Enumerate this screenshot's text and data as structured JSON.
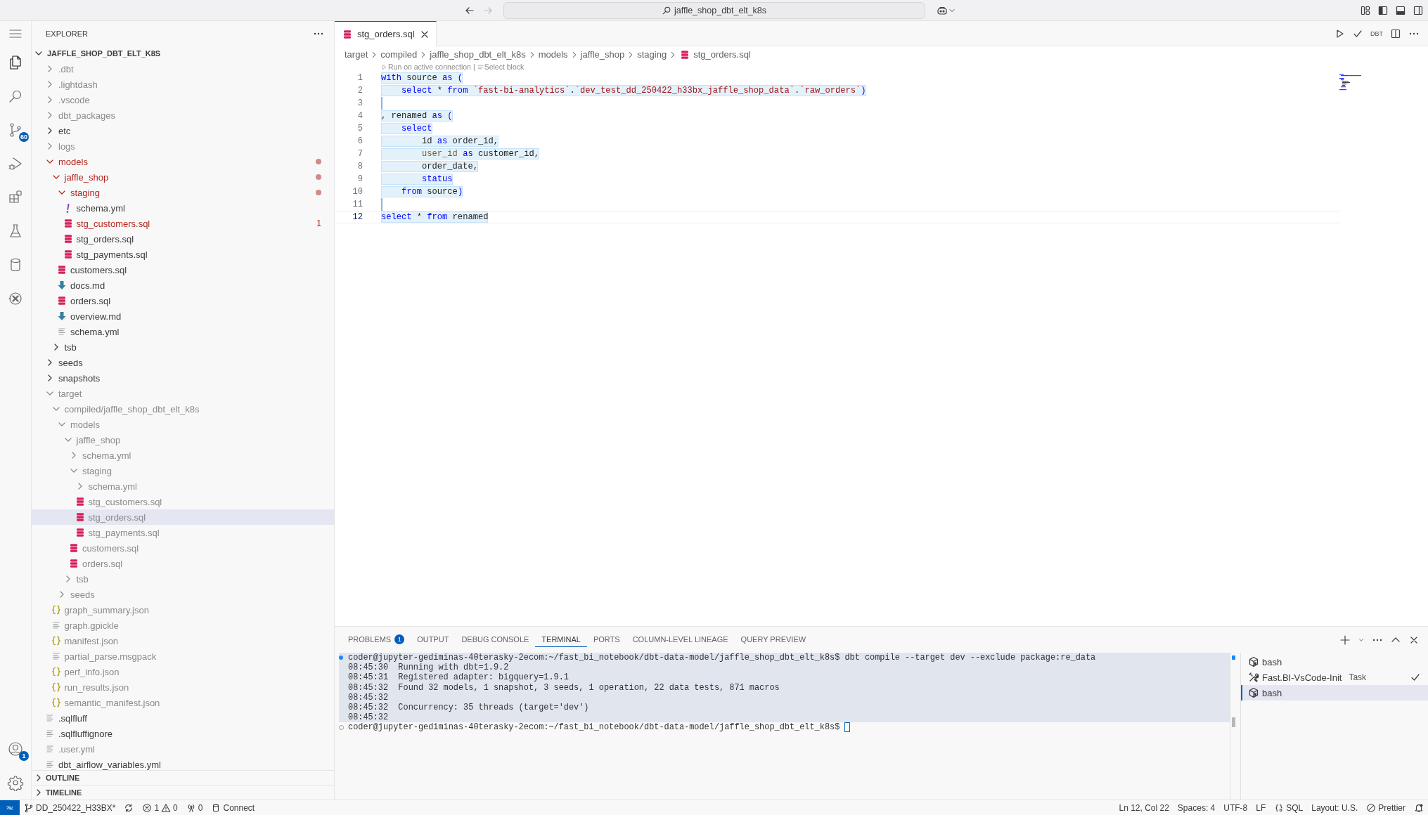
{
  "title_bar": {
    "navigation": [
      {
        "kind": "back",
        "disabled": false
      },
      {
        "kind": "forward",
        "disabled": true
      }
    ],
    "search": {
      "value": "jaffle_shop_dbt_elt_k8s"
    }
  },
  "activity_bar": {
    "items": [
      {
        "kind": "menu",
        "selected": false
      },
      {
        "kind": "explorer",
        "selected": true
      },
      {
        "kind": "search",
        "selected": false
      },
      {
        "kind": "source-control",
        "badge": "60",
        "selected": false
      },
      {
        "kind": "run-debug",
        "selected": false
      },
      {
        "kind": "extensions",
        "selected": false
      },
      {
        "kind": "testing",
        "selected": false
      },
      {
        "kind": "database",
        "selected": false
      },
      {
        "kind": "dbt",
        "selected": false
      }
    ],
    "bottom": [
      {
        "kind": "account",
        "badge": "1"
      },
      {
        "kind": "settings"
      }
    ]
  },
  "explorer": {
    "title": "EXPLORER",
    "root": {
      "name": "JAFFLE_SHOP_DBT_ELT_K8S",
      "expanded": true,
      "children": [
        {
          "name": ".dbt",
          "kind": "folder",
          "expanded": false,
          "ignored": true,
          "modified": false,
          "selected": false
        },
        {
          "name": ".lightdash",
          "kind": "folder",
          "expanded": false,
          "ignored": true,
          "modified": false,
          "selected": false
        },
        {
          "name": ".vscode",
          "kind": "folder",
          "expanded": false,
          "ignored": true,
          "modified": false,
          "selected": false
        },
        {
          "name": "dbt_packages",
          "kind": "folder",
          "expanded": false,
          "ignored": true,
          "modified": false,
          "selected": false
        },
        {
          "name": "etc",
          "kind": "folder",
          "expanded": false,
          "ignored": false,
          "modified": false,
          "selected": false
        },
        {
          "name": "logs",
          "kind": "folder",
          "expanded": false,
          "ignored": true,
          "modified": false,
          "selected": false
        },
        {
          "name": "models",
          "kind": "folder",
          "expanded": true,
          "ignored": false,
          "modified": true,
          "selected": false,
          "children": [
            {
              "name": "jaffle_shop",
              "kind": "folder",
              "expanded": true,
              "ignored": false,
              "modified": true,
              "selected": false,
              "children": [
                {
                  "name": "staging",
                  "kind": "folder",
                  "expanded": true,
                  "ignored": false,
                  "modified": true,
                  "selected": false,
                  "children": [
                    {
                      "name": "schema.yml",
                      "kind": "yml-warn",
                      "ignored": false,
                      "modified": false,
                      "selected": false
                    },
                    {
                      "name": "stg_customers.sql",
                      "kind": "sql",
                      "ignored": false,
                      "modified": false,
                      "problems": "1",
                      "selected": false
                    },
                    {
                      "name": "stg_orders.sql",
                      "kind": "sql",
                      "ignored": false,
                      "modified": false,
                      "selected": false
                    },
                    {
                      "name": "stg_payments.sql",
                      "kind": "sql",
                      "ignored": false,
                      "modified": false,
                      "selected": false
                    }
                  ]
                },
                {
                  "name": "customers.sql",
                  "kind": "sql",
                  "ignored": false,
                  "modified": false,
                  "selected": false
                },
                {
                  "name": "docs.md",
                  "kind": "markdown",
                  "ignored": false,
                  "modified": false,
                  "selected": false
                },
                {
                  "name": "orders.sql",
                  "kind": "sql",
                  "ignored": false,
                  "modified": false,
                  "selected": false
                },
                {
                  "name": "overview.md",
                  "kind": "markdown",
                  "ignored": false,
                  "modified": false,
                  "selected": false
                },
                {
                  "name": "schema.yml",
                  "kind": "text",
                  "ignored": false,
                  "modified": false,
                  "selected": false
                }
              ]
            },
            {
              "name": "tsb",
              "kind": "folder",
              "expanded": false,
              "ignored": false,
              "modified": false,
              "selected": false
            }
          ]
        },
        {
          "name": "seeds",
          "kind": "folder",
          "expanded": false,
          "ignored": false,
          "modified": false,
          "selected": false
        },
        {
          "name": "snapshots",
          "kind": "folder",
          "expanded": false,
          "ignored": false,
          "modified": false,
          "selected": false
        },
        {
          "name": "target",
          "kind": "folder",
          "expanded": true,
          "ignored": true,
          "modified": false,
          "selected": false,
          "children": [
            {
              "name": "compiled/jaffle_shop_dbt_elt_k8s",
              "kind": "folder",
              "expanded": true,
              "ignored": true,
              "modified": false,
              "selected": false,
              "children": [
                {
                  "name": "models",
                  "kind": "folder",
                  "expanded": true,
                  "ignored": true,
                  "modified": false,
                  "selected": false,
                  "children": [
                    {
                      "name": "jaffle_shop",
                      "kind": "folder",
                      "expanded": true,
                      "ignored": true,
                      "modified": false,
                      "selected": false,
                      "children": [
                        {
                          "name": "schema.yml",
                          "kind": "folder",
                          "expanded": false,
                          "ignored": true,
                          "modified": false,
                          "selected": false
                        },
                        {
                          "name": "staging",
                          "kind": "folder",
                          "expanded": true,
                          "ignored": true,
                          "modified": false,
                          "selected": false,
                          "children": [
                            {
                              "name": "schema.yml",
                              "kind": "folder",
                              "expanded": false,
                              "ignored": true,
                              "modified": false,
                              "selected": false
                            },
                            {
                              "name": "stg_customers.sql",
                              "kind": "sql",
                              "ignored": true,
                              "modified": false,
                              "selected": false
                            },
                            {
                              "name": "stg_orders.sql",
                              "kind": "sql",
                              "ignored": true,
                              "modified": false,
                              "selected": true
                            },
                            {
                              "name": "stg_payments.sql",
                              "kind": "sql",
                              "ignored": true,
                              "modified": false,
                              "selected": false
                            }
                          ]
                        },
                        {
                          "name": "customers.sql",
                          "kind": "sql",
                          "ignored": true,
                          "modified": false,
                          "selected": false
                        },
                        {
                          "name": "orders.sql",
                          "kind": "sql",
                          "ignored": true,
                          "modified": false,
                          "selected": false
                        }
                      ]
                    },
                    {
                      "name": "tsb",
                      "kind": "folder",
                      "expanded": false,
                      "ignored": true,
                      "modified": false,
                      "selected": false
                    }
                  ]
                },
                {
                  "name": "seeds",
                  "kind": "folder",
                  "expanded": false,
                  "ignored": true,
                  "modified": false,
                  "selected": false
                }
              ]
            },
            {
              "name": "graph_summary.json",
              "kind": "json",
              "ignored": true,
              "modified": false,
              "selected": false
            },
            {
              "name": "graph.gpickle",
              "kind": "text",
              "ignored": true,
              "modified": false,
              "selected": false
            },
            {
              "name": "manifest.json",
              "kind": "json",
              "ignored": true,
              "modified": false,
              "selected": false
            },
            {
              "name": "partial_parse.msgpack",
              "kind": "text",
              "ignored": true,
              "modified": false,
              "selected": false
            },
            {
              "name": "perf_info.json",
              "kind": "json",
              "ignored": true,
              "modified": false,
              "selected": false
            },
            {
              "name": "run_results.json",
              "kind": "json",
              "ignored": true,
              "modified": false,
              "selected": false
            },
            {
              "name": "semantic_manifest.json",
              "kind": "json",
              "ignored": true,
              "modified": false,
              "selected": false
            }
          ]
        },
        {
          "name": ".sqlfluff",
          "kind": "text",
          "ignored": false,
          "modified": false,
          "selected": false
        },
        {
          "name": ".sqlfluffignore",
          "kind": "text",
          "ignored": false,
          "modified": false,
          "selected": false
        },
        {
          "name": ".user.yml",
          "kind": "text",
          "ignored": true,
          "modified": false,
          "selected": false
        },
        {
          "name": "dbt_airflow_variables.yml",
          "kind": "text",
          "ignored": false,
          "modified": false,
          "selected": false
        }
      ]
    },
    "sections": [
      {
        "title": "OUTLINE",
        "expanded": false
      },
      {
        "title": "TIMELINE",
        "expanded": false
      }
    ]
  },
  "editor": {
    "tabs": [
      {
        "label": "stg_orders.sql",
        "kind": "sql",
        "selected": true
      }
    ],
    "actions": [
      {
        "kind": "run"
      },
      {
        "kind": "check"
      },
      {
        "kind": "label",
        "label": "DBT"
      },
      {
        "kind": "split"
      },
      {
        "kind": "more"
      }
    ],
    "breadcrumbs": [
      {
        "label": "target",
        "kind": "folder"
      },
      {
        "label": "compiled",
        "kind": "folder"
      },
      {
        "label": "jaffle_shop_dbt_elt_k8s",
        "kind": "folder"
      },
      {
        "label": "models",
        "kind": "folder"
      },
      {
        "label": "jaffle_shop",
        "kind": "folder"
      },
      {
        "label": "staging",
        "kind": "folder"
      },
      {
        "label": "stg_orders.sql",
        "kind": "sql"
      }
    ],
    "codelens": {
      "items": [
        {
          "label": "Run on active connection",
          "kind": "run"
        },
        {
          "label": "Select block",
          "kind": "lines"
        }
      ],
      "separator": "|"
    },
    "lines": [
      {
        "number": "1",
        "current": false,
        "tokens": [
          {
            "text": "with",
            "kind": "kw"
          },
          {
            "text": " source ",
            "kind": "p"
          },
          {
            "text": "as",
            "kind": "kw"
          },
          {
            "text": " (",
            "kind": "kw"
          }
        ]
      },
      {
        "number": "2",
        "current": false,
        "tokens": [
          {
            "text": "    select",
            "kind": "kw"
          },
          {
            "text": " * ",
            "kind": "p"
          },
          {
            "text": "from ",
            "kind": "kw"
          },
          {
            "text": "`fast-bi-analytics`",
            "kind": "str"
          },
          {
            "text": ".",
            "kind": "p"
          },
          {
            "text": "`dev_test_dd_250422_h33bx_jaffle_shop_data`",
            "kind": "str"
          },
          {
            "text": ".",
            "kind": "p"
          },
          {
            "text": "`raw_orders`",
            "kind": "str"
          },
          {
            "text": ")",
            "kind": "kw"
          }
        ]
      },
      {
        "number": "3",
        "current": false
      },
      {
        "number": "4",
        "current": false,
        "tokens": [
          {
            "text": ", renamed ",
            "kind": "p"
          },
          {
            "text": "as",
            "kind": "kw"
          },
          {
            "text": " (",
            "kind": "kw"
          }
        ]
      },
      {
        "number": "5",
        "current": false,
        "tokens": [
          {
            "text": "    select",
            "kind": "kw"
          }
        ]
      },
      {
        "number": "6",
        "current": false,
        "tokens": [
          {
            "text": "        id ",
            "kind": "p"
          },
          {
            "text": "as",
            "kind": "kw"
          },
          {
            "text": " order_id,",
            "kind": "p"
          }
        ]
      },
      {
        "number": "7",
        "current": false,
        "tokens": [
          {
            "text": "        user_id ",
            "kind": "var"
          },
          {
            "text": "as",
            "kind": "kw"
          },
          {
            "text": " customer_id,",
            "kind": "p"
          }
        ]
      },
      {
        "number": "8",
        "current": false,
        "tokens": [
          {
            "text": "        order_date,",
            "kind": "p"
          }
        ]
      },
      {
        "number": "9",
        "current": false,
        "tokens": [
          {
            "text": "        status",
            "kind": "kw"
          }
        ]
      },
      {
        "number": "10",
        "current": false,
        "tokens": [
          {
            "text": "    from",
            "kind": "kw"
          },
          {
            "text": " source",
            "kind": "p"
          },
          {
            "text": ")",
            "kind": "kw"
          }
        ]
      },
      {
        "number": "11",
        "current": false
      },
      {
        "number": "12",
        "current": true,
        "tokens": [
          {
            "text": "select",
            "kind": "kw"
          },
          {
            "text": " * ",
            "kind": "p"
          },
          {
            "text": "from",
            "kind": "kw"
          },
          {
            "text": " renamed",
            "kind": "p"
          }
        ]
      }
    ]
  },
  "panel": {
    "tabs": [
      {
        "label": "PROBLEMS",
        "badge": "1",
        "selected": false
      },
      {
        "label": "OUTPUT",
        "selected": false
      },
      {
        "label": "DEBUG CONSOLE",
        "selected": false
      },
      {
        "label": "TERMINAL",
        "selected": true
      },
      {
        "label": "PORTS",
        "selected": false
      },
      {
        "label": "COLUMN-LEVEL LINEAGE",
        "selected": false
      },
      {
        "label": "QUERY PREVIEW",
        "selected": false
      }
    ],
    "terminal": {
      "block_highlighted": true,
      "command": {
        "kind": "success",
        "text": "coder@jupyter-gediminas-40terasky-2ecom:~/fast_bi_notebook/dbt-data-model/jaffle_shop_dbt_elt_k8s$ dbt compile --target dev --exclude package:re_data"
      },
      "output": [
        "08:45:30  Running with dbt=1.9.2",
        "08:45:31  Registered adapter: bigquery=1.9.1",
        "08:45:32  Found 32 models, 1 snapshot, 3 seeds, 1 operation, 22 data tests, 871 macros",
        "08:45:32",
        "08:45:32  Concurrency: 35 threads (target='dev')",
        "08:45:32"
      ],
      "prompt": {
        "kind": "idle",
        "text": "coder@jupyter-gediminas-40terasky-2ecom:~/fast_bi_notebook/dbt-data-model/jaffle_shop_dbt_elt_k8s$",
        "cursor": true
      }
    },
    "instances": [
      {
        "name": "bash",
        "kind": "shell",
        "done": false,
        "selected": false
      },
      {
        "name": "Fast.BI-VsCode-Init",
        "kind": "task",
        "tag": "Task",
        "done": true,
        "selected": false
      },
      {
        "name": "bash",
        "kind": "shell",
        "done": false,
        "selected": true
      }
    ]
  },
  "status_bar": {
    "left": [
      {
        "kind": "remote"
      },
      {
        "kind": "branch",
        "text": "DD_250422_H33BX*"
      },
      {
        "kind": "sync"
      },
      {
        "kind": "problems",
        "errors": "1",
        "warnings": "0"
      },
      {
        "kind": "ports",
        "text": "0"
      },
      {
        "kind": "connection",
        "text": "Connect"
      }
    ],
    "right": [
      {
        "kind": "plain",
        "text": "Ln 12, Col 22"
      },
      {
        "kind": "plain",
        "text": "Spaces: 4"
      },
      {
        "kind": "plain",
        "text": "UTF-8"
      },
      {
        "kind": "plain",
        "text": "LF"
      },
      {
        "kind": "language",
        "text": "SQL"
      },
      {
        "kind": "plain",
        "text": "Layout: U.S."
      },
      {
        "kind": "formatter",
        "text": "Prettier"
      },
      {
        "kind": "bell"
      }
    ]
  }
}
